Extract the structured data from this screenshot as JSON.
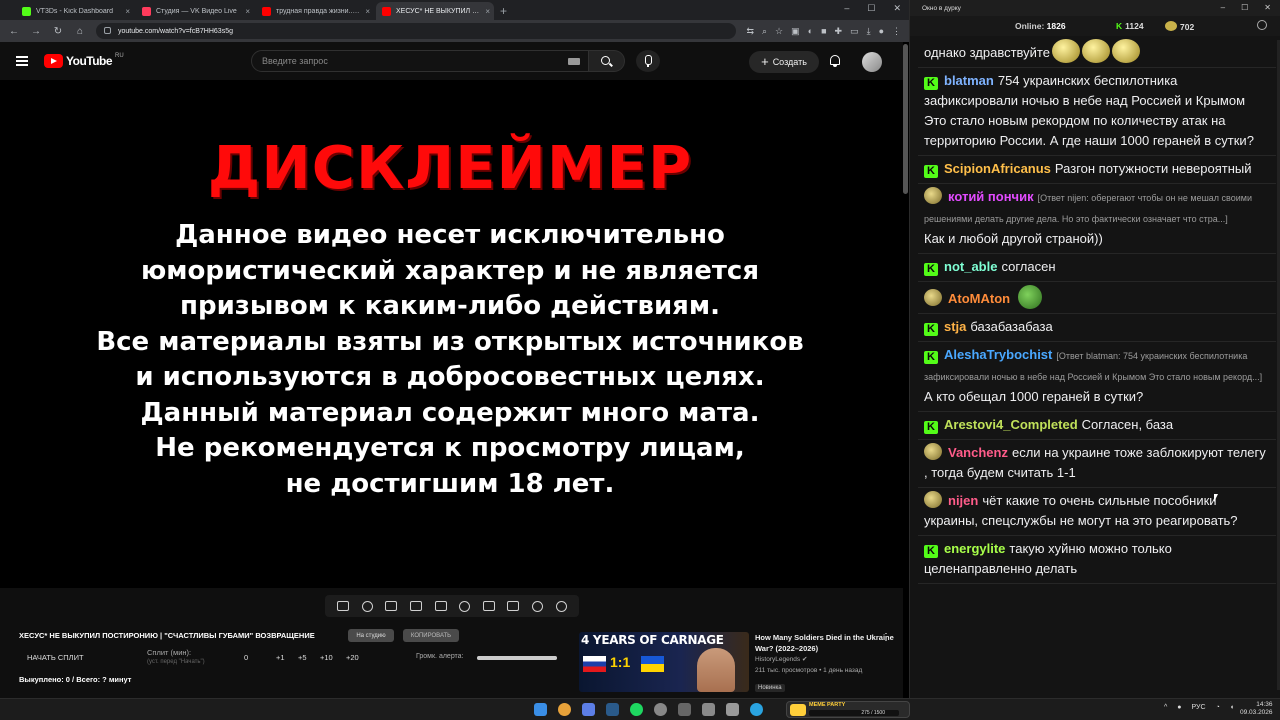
{
  "browser": {
    "tabs": [
      {
        "label": "VT3Ds - Kick Dashboard",
        "icon": "kick-icon",
        "color": "#53fc18"
      },
      {
        "label": "Студия — VK Видео Live",
        "icon": "vk-video-icon",
        "color": "#ff3b5c"
      },
      {
        "label": "трудная правда жизни... - YouTube",
        "icon": "youtube-icon",
        "color": "#ff0000"
      },
      {
        "label": "ХЕСУС* НЕ ВЫКУПИЛ ПОСТИРОНИЮ",
        "icon": "youtube-icon",
        "color": "#ff0000"
      }
    ],
    "url": "youtube.com/watch?v=fcB7HH63s5g"
  },
  "youtube": {
    "logo": "YouTube",
    "region": "RU",
    "search_placeholder": "Введите запрос",
    "create_label": "Создать"
  },
  "video": {
    "title": "ДИСКЛЕЙМЕР",
    "lines": [
      "Данное видео несет исключительно",
      "юмористический характер и не является",
      "призывом к каким-либо действиям.",
      "Все материалы взяты из открытых источников",
      "и используются в добросовестных целях.",
      "Данный материал содержит много мата.",
      "Не рекомендуется к просмотру лицам,",
      "не достигшим 18 лет."
    ]
  },
  "panel": {
    "stream_title": "ХЕСУС* НЕ ВЫКУПИЛ ПОСТИРОНИЮ | \"СЧАСТЛИВЫ ГУБАМИ\" ВОЗВРАЩЕНИЕ",
    "btn_studio": "На студию",
    "btn_copy": "КОПИРОВАТЬ",
    "start_split": "НАЧАТЬ СПЛИТ",
    "split_label": "Сплит (мин):",
    "split_sub": "(уст. перед \"Начать\")",
    "split_values": [
      "0",
      "+1",
      "+5",
      "+10",
      "+20"
    ],
    "alert_label": "Громк. алерта:",
    "alert_volume": 1.0,
    "buyout": "Выкуплено: 0 / Всего: ? минут"
  },
  "related": {
    "thumb_text": "4 YEARS OF CARNAGE",
    "thumb_score": "1:1",
    "title": "How Many Soldiers Died in the Ukraine War? (2022–2026)",
    "channel": "HistoryLegends",
    "meta": "211 тыс. просмотров • 1 день назад",
    "badge": "Новинка"
  },
  "chat": {
    "window_title": "Окно в дурку",
    "online_label": "Online:",
    "online": "1826",
    "kick_count": "1124",
    "emote_count": "702",
    "messages": [
      {
        "badge": "none",
        "user": "",
        "color": "#efeff1",
        "reply": "",
        "text": "однако здравствуйте",
        "emotes": 3
      },
      {
        "badge": "kick",
        "user": "blatman",
        "color": "#7fb3ff",
        "reply": "",
        "text": "754 украинских беспилотника зафиксировали ночью в небе над Россией и Крымом Это стало новым рекордом по количеству атак на территорию России. А где наши 1000 гераней в сутки?"
      },
      {
        "badge": "kick",
        "user": "ScipionAfricanus",
        "color": "#ffbf4a",
        "reply": "",
        "text": "Разгон потужности невероятный"
      },
      {
        "badge": "emote",
        "user": "котий пончик",
        "color": "#e24bff",
        "reply": "[Ответ nijen: оберегают чтобы он не мешал своими решениями делать другие дела. Но это фактически означает что стра...]",
        "text": "Как и любой другой страной))"
      },
      {
        "badge": "kick",
        "user": "not_able",
        "color": "#7fffd4",
        "reply": "",
        "text": "согласен"
      },
      {
        "badge": "emote",
        "user": "AtoMAton",
        "color": "#ff8c3a",
        "reply": "",
        "text": "",
        "pepe": true
      },
      {
        "badge": "kick",
        "user": "stja",
        "color": "#ffb347",
        "reply": "",
        "text": "базабазабаза"
      },
      {
        "badge": "kick",
        "user": "AleshaTrybochist",
        "color": "#4aa8ff",
        "reply": "[Ответ blatman: 754 украинских беспилотника зафиксировали ночью в небе над Россией и Крымом Это стало новым рекорд...]",
        "text": "А кто обещал 1000 гераней в сутки?"
      },
      {
        "badge": "kick",
        "user": "Arestovi4_Completed",
        "color": "#c0e15a",
        "reply": "",
        "text": "Согласен, база"
      },
      {
        "badge": "emote",
        "user": "Vanchenz",
        "color": "#ff5c8a",
        "reply": "",
        "text": "если на украине тоже заблокируют телегу , тогда будем считать 1-1"
      },
      {
        "badge": "emote",
        "user": "nijen",
        "color": "#ff5c8a",
        "reply": "",
        "text": "чёт какие то очень сильные пособники украины, спецслужбы не могут на это реагировать?"
      },
      {
        "badge": "kick",
        "user": "energylite",
        "color": "#a8ff4a",
        "reply": "",
        "text": "такую хуйню можно только целенаправленно делать"
      }
    ]
  },
  "taskbar": {
    "meme_label": "MEME PARTY",
    "meme_progress": "275 / 1500",
    "lang": "РУС",
    "time": "14:36",
    "date": "09.03.2026"
  }
}
